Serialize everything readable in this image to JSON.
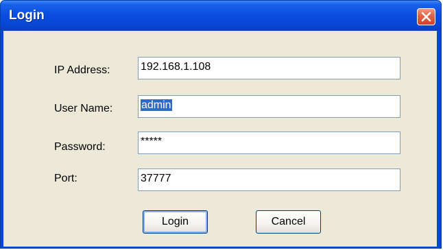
{
  "window": {
    "title": "Login",
    "close_icon": "close-icon"
  },
  "form": {
    "ip_label": "IP Address:",
    "ip_value": "192.168.1.108",
    "username_label": "User Name:",
    "username_value": "admin",
    "password_label": "Password:",
    "password_value": "*****",
    "port_label": "Port:",
    "port_value": "37777"
  },
  "buttons": {
    "login_label": "Login",
    "cancel_label": "Cancel"
  },
  "colors": {
    "titlebar": "#0a4ee0",
    "body": "#ece9d8",
    "close_button": "#e0664a",
    "selection": "#316ac5"
  }
}
